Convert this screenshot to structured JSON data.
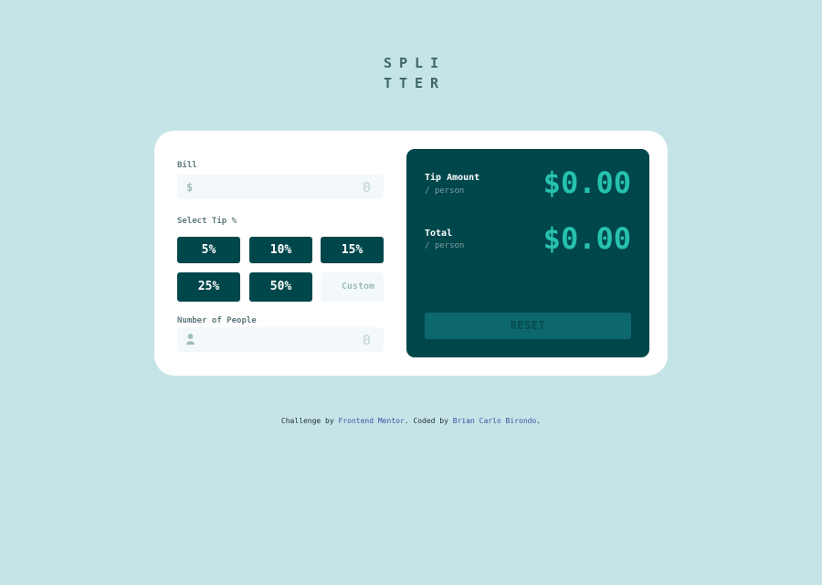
{
  "logo": {
    "line1": "SPLI",
    "line2": "TTER"
  },
  "calculator": {
    "bill": {
      "label": "Bill",
      "prefix": "$",
      "value": "0"
    },
    "tip": {
      "label": "Select Tip %",
      "options": [
        "5%",
        "10%",
        "15%",
        "25%",
        "50%"
      ],
      "custom_placeholder": "Custom"
    },
    "people": {
      "label": "Number of People",
      "value": "0"
    }
  },
  "results": {
    "tip_amount": {
      "label": "Tip Amount",
      "sub": "/ person",
      "value": "$0.00"
    },
    "total": {
      "label": "Total",
      "sub": "/ person",
      "value": "$0.00"
    },
    "reset_label": "RESET"
  },
  "attribution": {
    "prefix": "Challenge by ",
    "link1": "Frontend Mentor",
    "middle": ". Coded by ",
    "link2": "Brian Carlo Birondo",
    "suffix": "."
  },
  "colors": {
    "background": "#c5e4e7",
    "dark_cyan": "#00474b",
    "strong_cyan": "#26c2ae",
    "card": "#ffffff"
  }
}
